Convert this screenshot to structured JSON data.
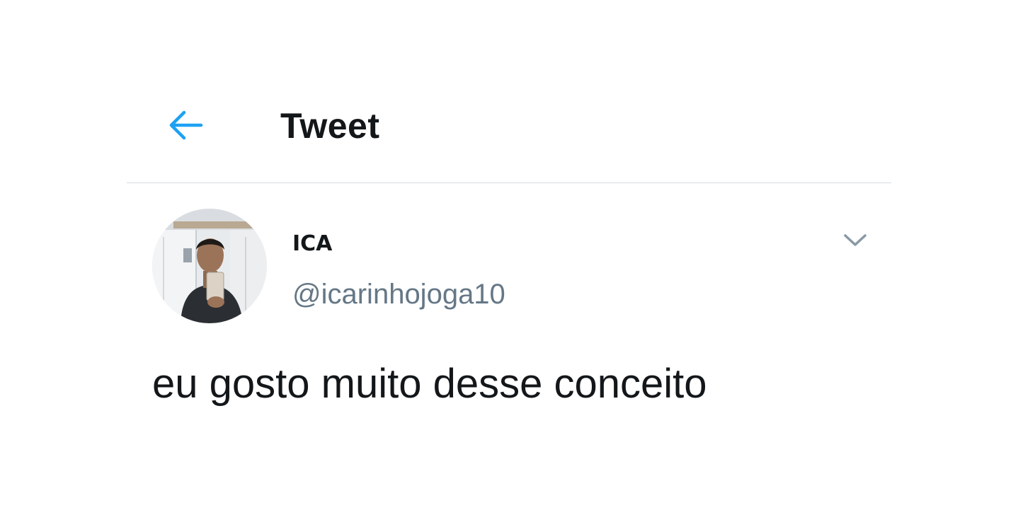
{
  "header": {
    "title": "Tweet",
    "back_icon": "arrow-left-icon",
    "accent_color": "#1da1f2"
  },
  "tweet": {
    "author": {
      "display_name": "ICA",
      "handle": "@icarinhojoga10",
      "avatar": "avatar-photo"
    },
    "menu_icon": "chevron-down-icon",
    "text": "eu gosto muito desse conceito"
  },
  "colors": {
    "text_primary": "#14171a",
    "text_secondary": "#657786",
    "divider": "#d6dbdf",
    "caret": "#8899a6"
  }
}
